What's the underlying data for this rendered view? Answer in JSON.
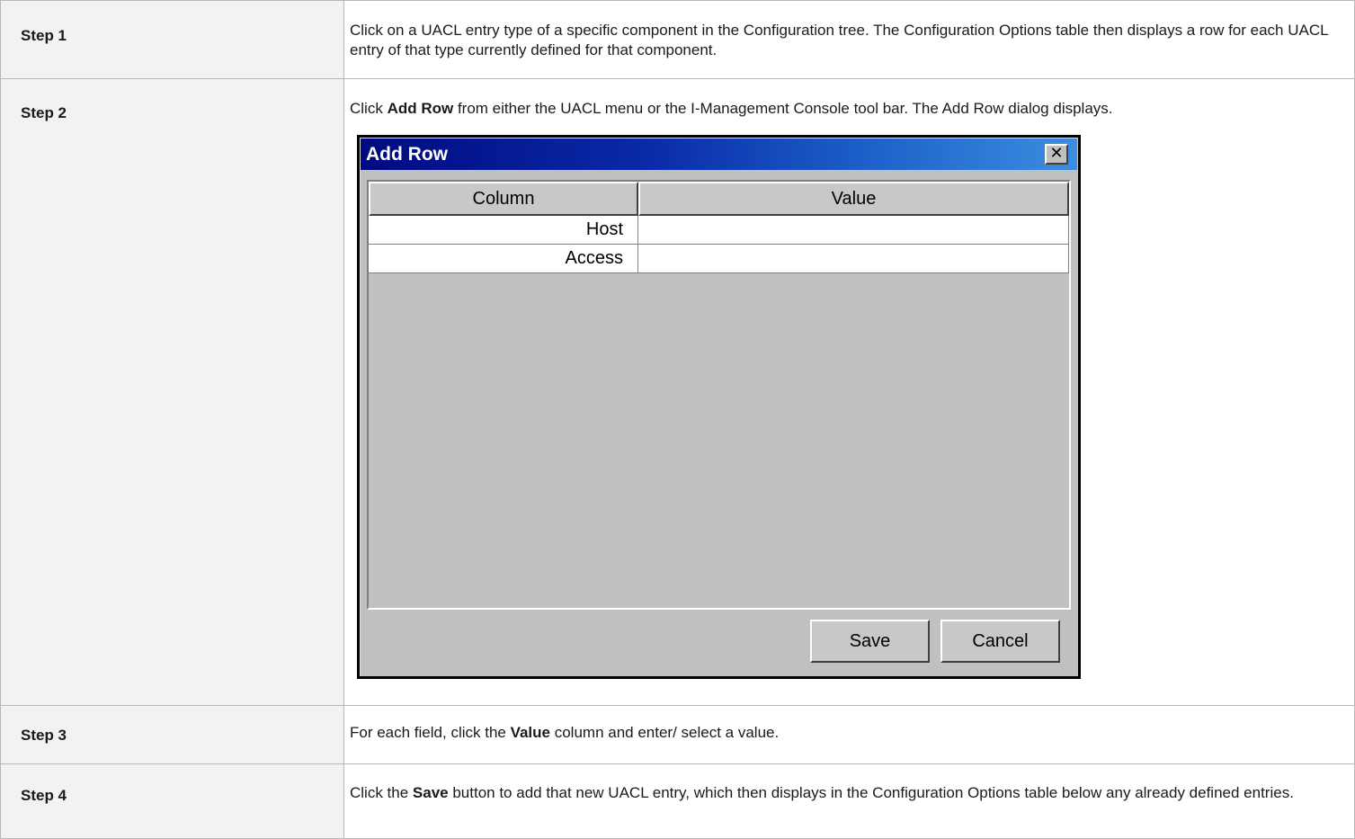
{
  "steps": [
    {
      "label": "Step 1",
      "text": "Click on a UACL entry type of a specific component in the Configuration tree. The Configuration Options table then displays a row for each UACL entry of that type currently defined for that component."
    },
    {
      "label": "Step 2",
      "pre": "Click ",
      "bold": "Add Row",
      "post": " from either the UACL menu or the I-Management Console tool bar. The Add Row dialog displays."
    },
    {
      "label": "Step 3",
      "pre": "For each field, click the ",
      "bold": "Value",
      "post": " column and enter/ select a value."
    },
    {
      "label": "Step 4",
      "pre": "Click the ",
      "bold": "Save",
      "post": " button to add that new UACL entry, which then displays in the Configuration Options table below any already defined entries."
    }
  ],
  "dialog": {
    "title": "Add Row",
    "close_glyph": "✕",
    "headers": [
      "Column",
      "Value"
    ],
    "rows": [
      {
        "column": "Host",
        "value": ""
      },
      {
        "column": "Access",
        "value": ""
      }
    ],
    "save_label": "Save",
    "cancel_label": "Cancel"
  }
}
